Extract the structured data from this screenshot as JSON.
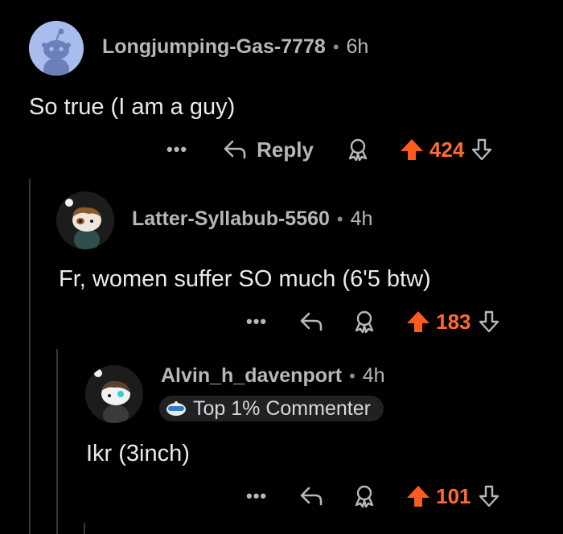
{
  "comments": [
    {
      "username": "Longjumping-Gas-7778",
      "time": "6h",
      "text": "So true (I am a guy)",
      "reply_label": "Reply",
      "score": "424",
      "more": "•••"
    },
    {
      "username": "Latter-Syllabub-5560",
      "time": "4h",
      "text": "Fr, women suffer SO much (6'5 btw)",
      "score": "183",
      "more": "•••"
    },
    {
      "username": "Alvin_h_davenport",
      "time": "4h",
      "badge": "Top 1% Commenter",
      "text": "Ikr (3inch)",
      "score": "101",
      "more": "•••"
    }
  ],
  "separator": "•",
  "colors": {
    "background": "#000000",
    "upvote": "#ff6a35",
    "text": "#e8eaec",
    "muted": "#b5b8ba",
    "thread_line": "#343536"
  },
  "icons": {
    "more": "more-options-icon",
    "reply": "reply-arrow-icon",
    "award": "award-icon",
    "upvote": "upvote-arrow-icon",
    "downvote": "downvote-arrow-icon"
  }
}
